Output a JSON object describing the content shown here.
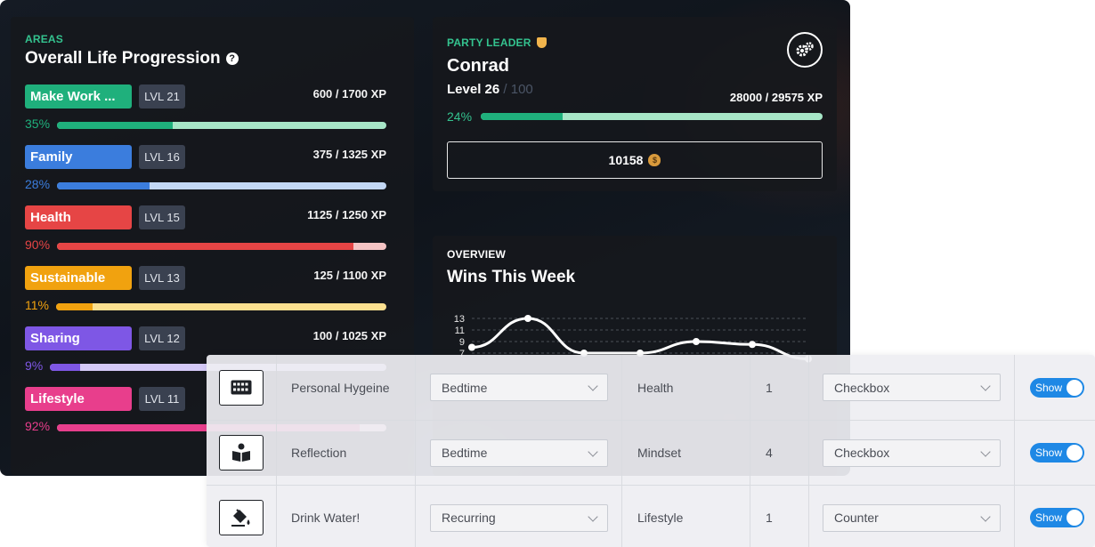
{
  "areas_panel": {
    "overline": "AREAS",
    "title": "Overall Life Progression",
    "help_icon": "?",
    "areas": [
      {
        "name": "Make Work ...",
        "level": "LVL 21",
        "xp": "600 / 1700 XP",
        "percent_label": "35%",
        "progress": 0.35,
        "color": "#1fb07c",
        "track": "#a7e6c7"
      },
      {
        "name": "Family",
        "level": "LVL 16",
        "xp": "375 / 1325 XP",
        "percent_label": "28%",
        "progress": 0.28,
        "color": "#3b7ddd",
        "track": "#c3d8f5"
      },
      {
        "name": "Health",
        "level": "LVL 15",
        "xp": "1125 / 1250 XP",
        "percent_label": "90%",
        "progress": 0.9,
        "color": "#e64545",
        "track": "#f5c4c4"
      },
      {
        "name": "Sustainable",
        "level": "LVL 13",
        "xp": "125 / 1100 XP",
        "percent_label": "11%",
        "progress": 0.11,
        "color": "#f1a20f",
        "track": "#fbe08f"
      },
      {
        "name": "Sharing",
        "level": "LVL 12",
        "xp": "100 / 1025 XP",
        "percent_label": "9%",
        "progress": 0.09,
        "color": "#7e57e5",
        "track": "#d4c9f7"
      },
      {
        "name": "Lifestyle",
        "level": "LVL 11",
        "xp": "",
        "percent_label": "92%",
        "progress": 0.92,
        "color": "#e83e8c",
        "track": "#f7c4dc"
      }
    ]
  },
  "party_leader": {
    "overline": "PARTY LEADER",
    "name": "Conrad",
    "level_label": "Level 26",
    "level_max": " / 100",
    "xp": "28000 / 29575 XP",
    "percent_label": "24%",
    "progress": 0.24,
    "coins": "10158"
  },
  "overview": {
    "overline": "OVERVIEW",
    "title": "Wins This Week"
  },
  "chart_data": {
    "type": "line",
    "title": "Wins This Week",
    "y_ticks": [
      "13",
      "11",
      "9",
      "7"
    ],
    "ylim": [
      7,
      13
    ],
    "x": [
      0,
      1,
      2,
      3,
      4,
      5,
      6
    ],
    "values": [
      8,
      13,
      7,
      7,
      9,
      8.5,
      6
    ],
    "color": "#ffffff",
    "grid": true
  },
  "rules_table": {
    "rows": [
      {
        "icon": "keyboard-icon",
        "name": "Personal Hygeine",
        "schedule": "Bedtime",
        "area": "Health",
        "points": "1",
        "type": "Checkbox",
        "toggle": "Show"
      },
      {
        "icon": "book-reader-icon",
        "name": "Reflection",
        "schedule": "Bedtime",
        "area": "Mindset",
        "points": "4",
        "type": "Checkbox",
        "toggle": "Show"
      },
      {
        "icon": "fill-drip-icon",
        "name": "Drink Water!",
        "schedule": "Recurring",
        "area": "Lifestyle",
        "points": "1",
        "type": "Counter",
        "toggle": "Show"
      }
    ]
  }
}
